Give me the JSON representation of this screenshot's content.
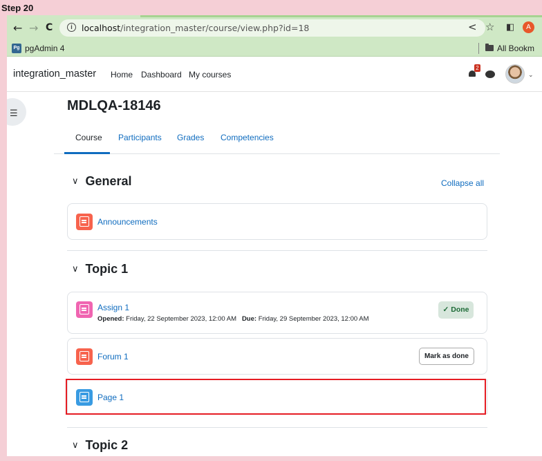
{
  "step_label": "Step 20",
  "browser": {
    "back": "←",
    "forward": "→",
    "reload": "C",
    "url_host": "localhost",
    "url_path": "/integration_master/course/view.php?id=18",
    "share_icon": "share-icon",
    "star_icon": "star-icon",
    "panel_icon": "side-panel-icon",
    "profile_initial": "A",
    "bookmark_pg_badge": "Pg",
    "bookmark_pgadmin": "pgAdmin 4",
    "all_bookmarks": "All Bookm"
  },
  "header": {
    "site_name": "integration_master",
    "nav": [
      "Home",
      "Dashboard",
      "My courses"
    ],
    "notification_count": "2"
  },
  "course": {
    "title": "MDLQA-18146",
    "tabs": [
      "Course",
      "Participants",
      "Grades",
      "Competencies"
    ],
    "active_tab": "Course",
    "collapse_all": "Collapse all",
    "sections": [
      {
        "name": "General",
        "activities": [
          {
            "name": "Announcements",
            "icon": "forum-icon"
          }
        ]
      },
      {
        "name": "Topic 1",
        "activities": [
          {
            "name": "Assign 1",
            "icon": "assignment-icon",
            "opened_label": "Opened:",
            "opened": "Friday, 22 September 2023, 12:00 AM",
            "due_label": "Due:",
            "due": "Friday, 29 September 2023, 12:00 AM",
            "completion": "Done"
          },
          {
            "name": "Forum 1",
            "icon": "forum-icon",
            "completion_button": "Mark as done"
          },
          {
            "name": "Page 1",
            "icon": "page-icon"
          }
        ]
      },
      {
        "name": "Topic 2",
        "activities": []
      }
    ]
  },
  "colors": {
    "link": "#0f6cbf",
    "communication_icon": "#f7634d",
    "assessment_icon": "#f065b1",
    "content_icon": "#399be2",
    "highlight": "#e51c23"
  }
}
